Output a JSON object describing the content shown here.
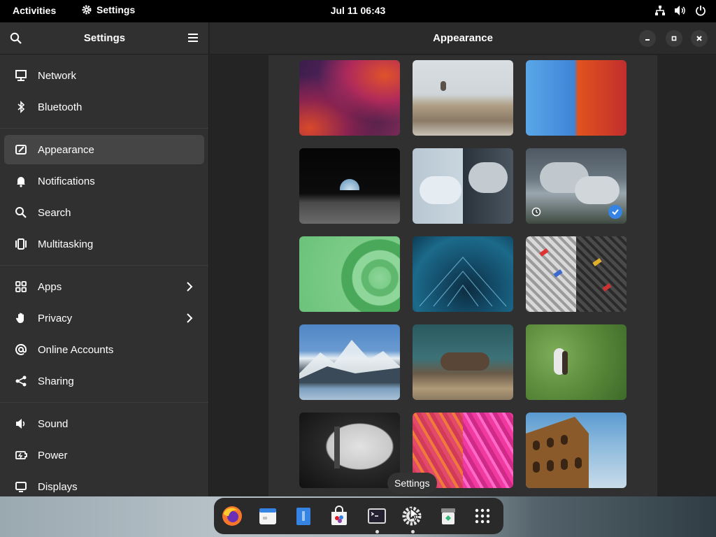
{
  "topbar": {
    "activities": "Activities",
    "app_name": "Settings",
    "clock": "Jul 11  06:43",
    "icons": [
      "network-icon",
      "volume-icon",
      "power-icon"
    ]
  },
  "sidebar": {
    "title": "Settings",
    "groups": [
      [
        {
          "label": "Network",
          "icon": "network-icon"
        },
        {
          "label": "Bluetooth",
          "icon": "bluetooth-icon"
        }
      ],
      [
        {
          "label": "Appearance",
          "icon": "appearance-icon",
          "active": true
        },
        {
          "label": "Notifications",
          "icon": "bell-icon"
        },
        {
          "label": "Search",
          "icon": "search-icon"
        },
        {
          "label": "Multitasking",
          "icon": "multitasking-icon"
        }
      ],
      [
        {
          "label": "Apps",
          "icon": "apps-icon",
          "chevron": true
        },
        {
          "label": "Privacy",
          "icon": "hand-icon",
          "chevron": true
        },
        {
          "label": "Online Accounts",
          "icon": "at-icon"
        },
        {
          "label": "Sharing",
          "icon": "share-icon"
        }
      ],
      [
        {
          "label": "Sound",
          "icon": "speaker-icon"
        },
        {
          "label": "Power",
          "icon": "battery-icon"
        },
        {
          "label": "Displays",
          "icon": "display-icon"
        }
      ]
    ]
  },
  "main": {
    "title": "Appearance"
  },
  "wallpapers": [
    {
      "name": "wallpaper-purple-waves"
    },
    {
      "name": "wallpaper-bird-on-rock"
    },
    {
      "name": "wallpaper-blue-orange-drips"
    },
    {
      "name": "wallpaper-earthrise"
    },
    {
      "name": "wallpaper-clouds-split"
    },
    {
      "name": "wallpaper-clouds",
      "selected": true
    },
    {
      "name": "wallpaper-green-waves"
    },
    {
      "name": "wallpaper-blue-tunnel"
    },
    {
      "name": "wallpaper-tiles"
    },
    {
      "name": "wallpaper-mountains"
    },
    {
      "name": "wallpaper-otter"
    },
    {
      "name": "wallpaper-osprey"
    },
    {
      "name": "wallpaper-building"
    },
    {
      "name": "wallpaper-pink-pattern"
    },
    {
      "name": "wallpaper-colosseum"
    }
  ],
  "dock": {
    "tooltip": "Settings",
    "apps": [
      "firefox-icon",
      "calendar-icon",
      "files-icon",
      "software-icon",
      "terminal-icon",
      "settings-icon",
      "trash-icon",
      "app-grid-icon"
    ]
  }
}
